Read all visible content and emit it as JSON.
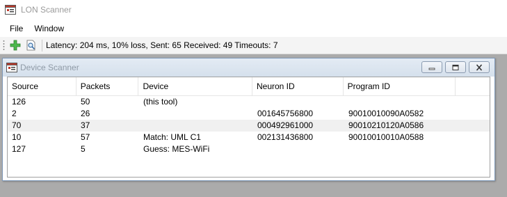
{
  "app": {
    "title": "LON Scanner"
  },
  "menu": [
    {
      "label": "File"
    },
    {
      "label": "Window"
    }
  ],
  "toolbar": {
    "add_icon": "plus-icon",
    "scan_icon": "magnifier-document-icon",
    "status": "Latency: 204 ms, 10% loss, Sent: 65 Received: 49 Timeouts: 7"
  },
  "device_scanner": {
    "title": "Device Scanner",
    "columns": [
      "Source",
      "Packets",
      "Device",
      "Neuron ID",
      "Program ID"
    ],
    "rows": [
      {
        "source": "126",
        "packets": "50",
        "device": "(this tool)",
        "neuron_id": "",
        "program_id": ""
      },
      {
        "source": "2",
        "packets": "26",
        "device": "",
        "neuron_id": "001645756800",
        "program_id": "90010010090A0582"
      },
      {
        "source": "70",
        "packets": "37",
        "device": "",
        "neuron_id": "000492961000",
        "program_id": "90010210120A0586"
      },
      {
        "source": "10",
        "packets": "57",
        "device": "Match: UML C1",
        "neuron_id": "002131436800",
        "program_id": "90010010010A0588"
      },
      {
        "source": "127",
        "packets": "5",
        "device": "Guess: MES-WiFi",
        "neuron_id": "",
        "program_id": ""
      }
    ]
  },
  "colors": {
    "accent_green": "#3aa63a",
    "icon_red": "#c0392b",
    "alt_row": "#f0f0f0",
    "mdi_background": "#ababab"
  }
}
